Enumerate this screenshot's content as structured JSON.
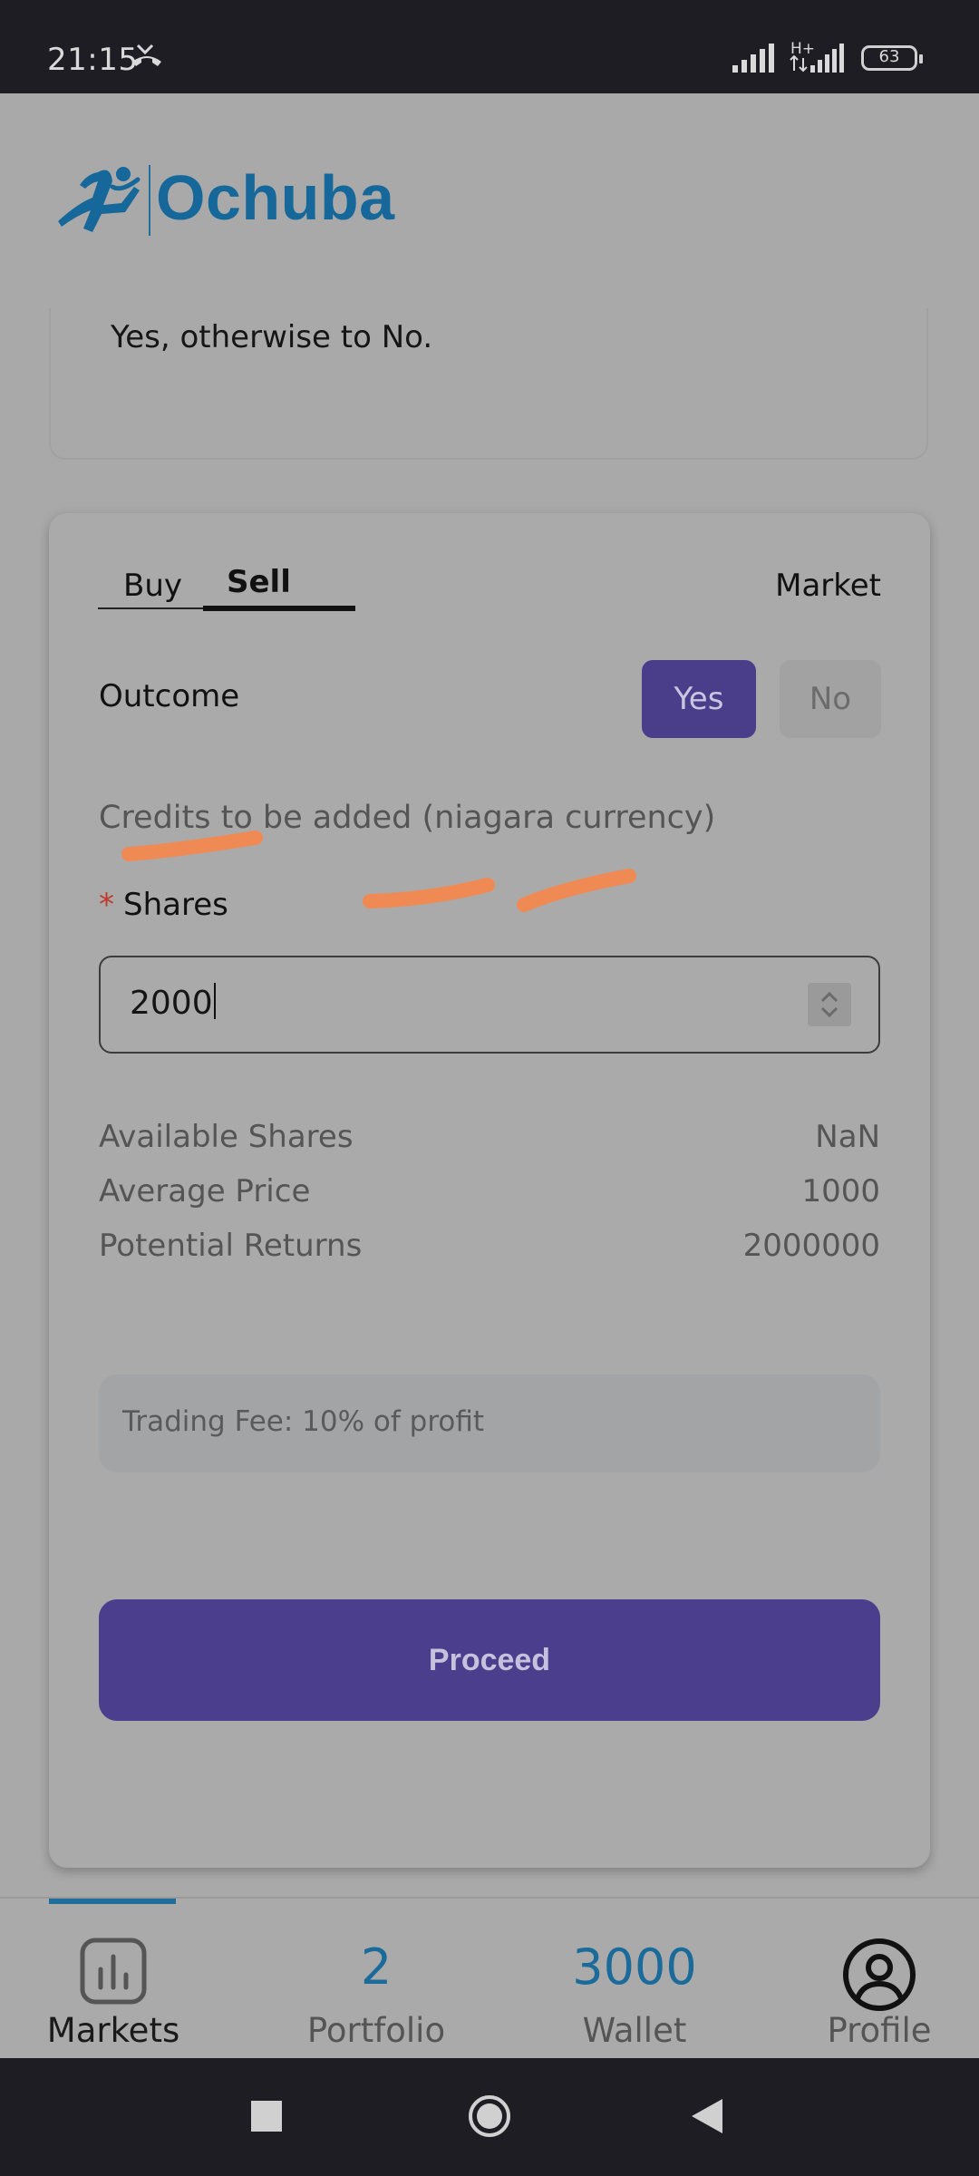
{
  "status_bar": {
    "time": "21:15",
    "network_label": "H+",
    "battery_level": "63",
    "icons": [
      "missed-call-icon",
      "signal-icon",
      "signal-icon",
      "battery-icon"
    ]
  },
  "header": {
    "brand": "Ochuba",
    "logo_icon": "runner-logo-icon"
  },
  "description": {
    "text": "Yes, otherwise to No."
  },
  "trade": {
    "tabs": [
      {
        "label": "Buy",
        "active": false
      },
      {
        "label": "Sell",
        "active": true
      }
    ],
    "order_type": "Market",
    "outcome_label": "Outcome",
    "outcome_options": [
      {
        "label": "Yes",
        "selected": true
      },
      {
        "label": "No",
        "selected": false
      }
    ],
    "credits_label": "Credits to be added (niagara currency)",
    "shares_required_mark": "*",
    "shares_label": "Shares",
    "shares_value": "2000",
    "info": [
      {
        "label": "Available Shares",
        "value": "NaN"
      },
      {
        "label": "Average Price",
        "value": "1000"
      },
      {
        "label": "Potential Returns",
        "value": "2000000"
      }
    ],
    "fee_note": "Trading Fee: 10% of profit",
    "proceed_label": "Proceed"
  },
  "bottom_nav": {
    "items": [
      {
        "label": "Markets",
        "icon": "bar-chart-icon",
        "active": true
      },
      {
        "label": "Portfolio",
        "value": "2"
      },
      {
        "label": "Wallet",
        "value": "3000"
      },
      {
        "label": "Profile",
        "icon": "user-circle-icon"
      }
    ]
  },
  "colors": {
    "accent": "#4b3e8c",
    "brand": "#16689a",
    "annotation": "#f08a55",
    "background": "#aaaaaa"
  }
}
